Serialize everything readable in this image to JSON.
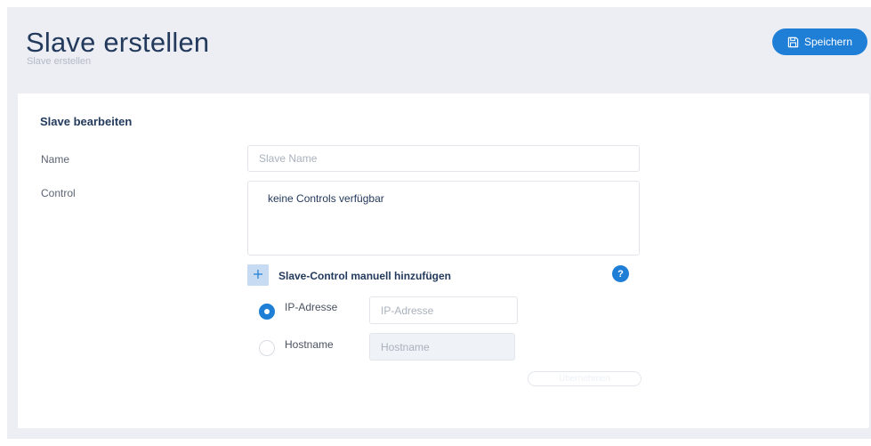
{
  "header": {
    "title": "Slave erstellen",
    "subtitle": "Slave erstellen",
    "save_label": "Speichern"
  },
  "form": {
    "section_title": "Slave bearbeiten",
    "name_label": "Name",
    "name_placeholder": "Slave Name",
    "name_value": "",
    "control_label": "Control",
    "control_empty_text": "keine Controls verfügbar",
    "add_control_label": "Slave-Control manuell hinzufügen",
    "help_symbol": "?",
    "ip_option_label": "IP-Adresse",
    "ip_placeholder": "IP-Adresse",
    "hostname_option_label": "Hostname",
    "hostname_placeholder": "Hostname",
    "selected_option": "IP-Adresse",
    "submit_label": "Übernehmen"
  },
  "colors": {
    "accent": "#1f7fd6",
    "title": "#233a5c",
    "background": "#eceef3"
  },
  "icons": {
    "save": "floppy-disk-icon",
    "add": "plus-icon",
    "help": "question-mark-icon"
  }
}
